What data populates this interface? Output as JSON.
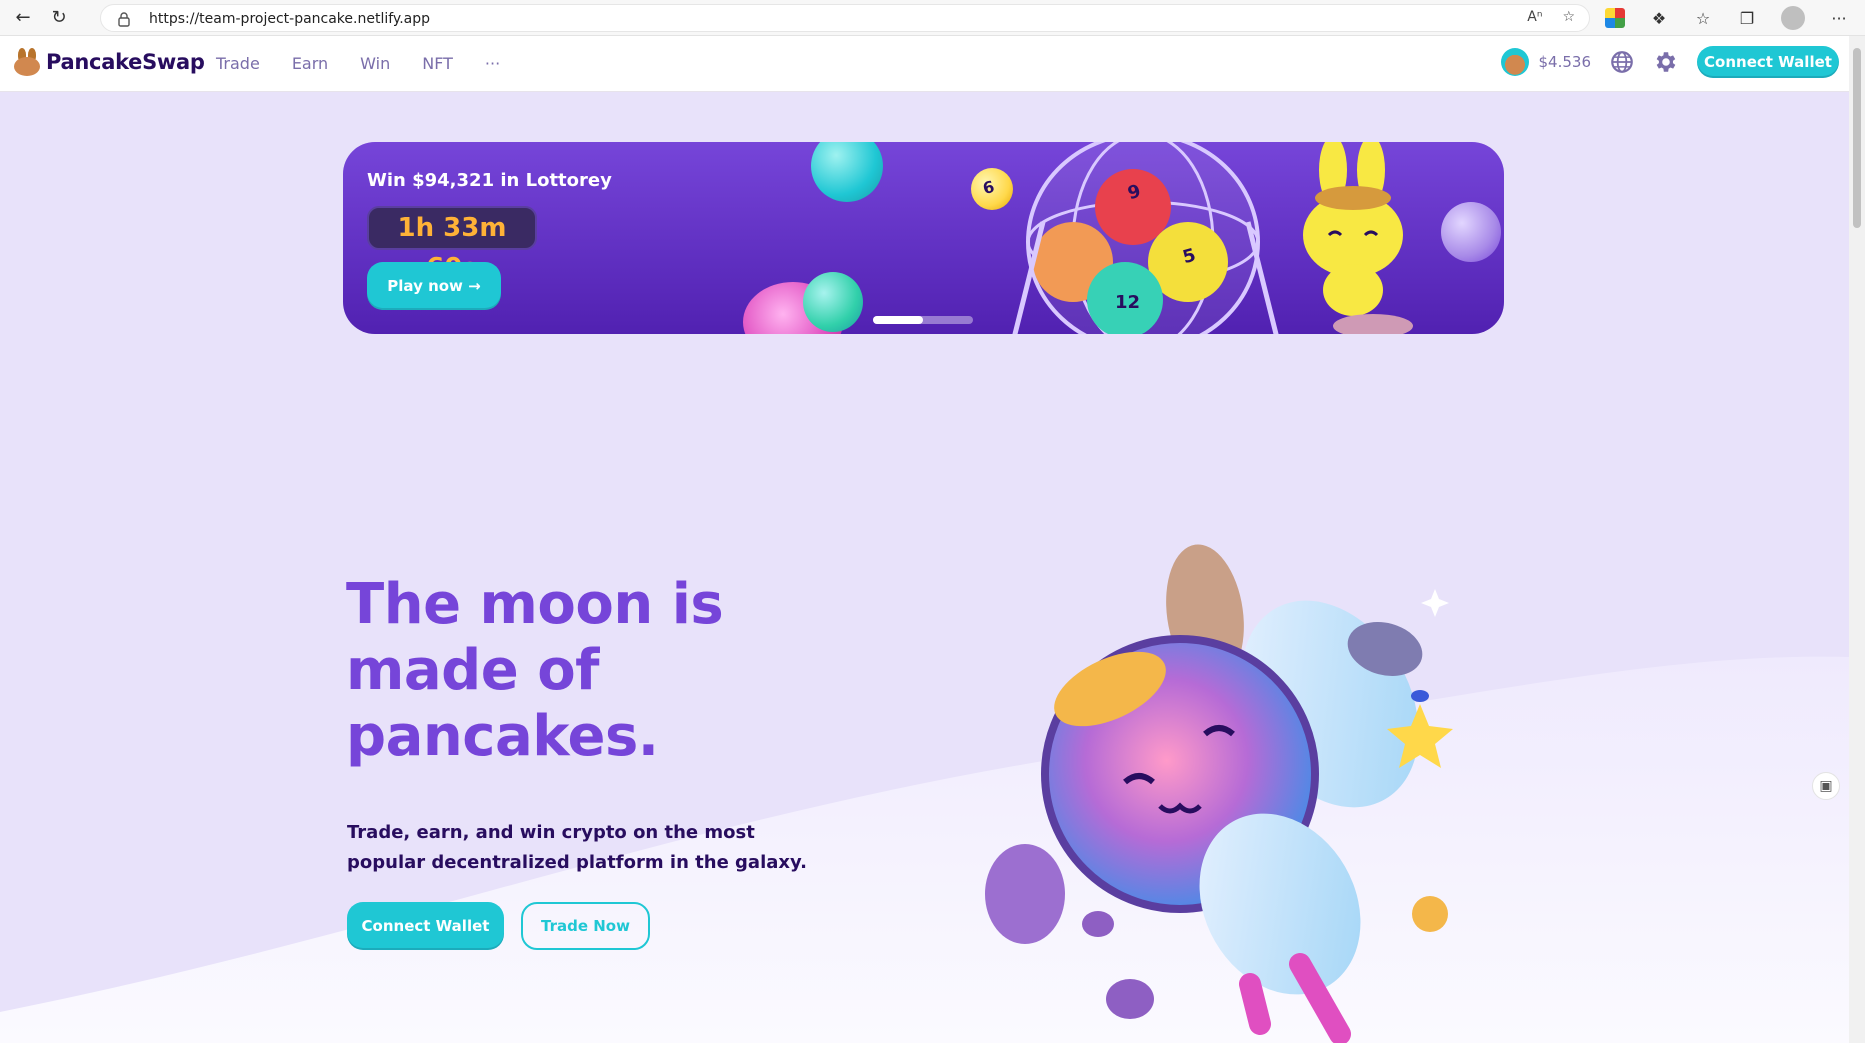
{
  "browser": {
    "url": "https://team-project-pancake.netlify.app",
    "back_icon": "arrow-left-icon",
    "reload_icon": "reload-icon"
  },
  "header": {
    "logo_text": "PancakeSwap",
    "nav": [
      "Trade",
      "Earn",
      "Win",
      "NFT",
      "···"
    ],
    "price": "$4.536",
    "connect_label": "Connect Wallet"
  },
  "banner": {
    "title": "Win $94,321 in Lottorey",
    "countdown": "1h 33m 60s",
    "play_label": "Play now →",
    "ball_numbers": [
      "6",
      "9",
      "5",
      "12"
    ],
    "slides": {
      "total": 2,
      "active": 1
    }
  },
  "hero": {
    "title": "The moon is made of pancakes.",
    "subtitle": "Trade, earn, and win crypto on the most popular decentralized platform in the galaxy.",
    "connect_label": "Connect Wallet",
    "trade_label": "Trade Now"
  },
  "colors": {
    "primary": "#1fc7d4",
    "secondary": "#7645d9",
    "text": "#280d5f",
    "text_subtle": "#7a6eaa",
    "background": "#e8e2fa"
  }
}
